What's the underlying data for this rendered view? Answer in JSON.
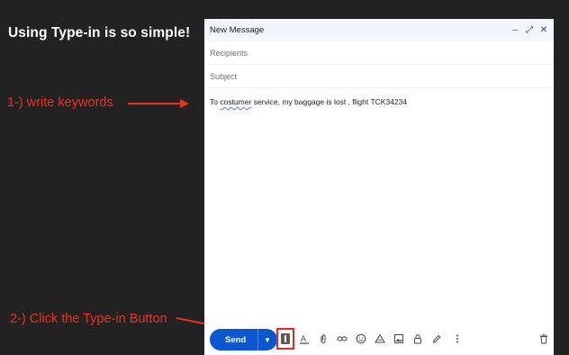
{
  "headline": "Using Type-in is so simple!",
  "annotations": {
    "step1": "1-) write keywords",
    "step2": "2-) Click the Type-in Button"
  },
  "compose": {
    "title": "New Message",
    "recipients_placeholder": "Recipients",
    "subject_placeholder": "Subject",
    "body_prefix": "To ",
    "body_misspelled": "costumer",
    "body_suffix": " service, my baggage is lost , flight TCK34234",
    "send_label": "Send"
  },
  "icons": {
    "header": [
      "minimize-icon",
      "expand-icon",
      "close-icon"
    ],
    "toolbar": [
      "send-options-chevron-icon",
      "type-in-icon",
      "text-format-icon",
      "attach-icon",
      "link-icon",
      "emoji-icon",
      "drive-icon",
      "photo-icon",
      "lock-icon",
      "signature-pen-icon",
      "more-options-icon",
      "trash-icon"
    ]
  },
  "colors": {
    "annotation": "#e8321e",
    "send_button": "#0b57d0",
    "highlight_box": "#e5281e",
    "background": "#222222"
  }
}
